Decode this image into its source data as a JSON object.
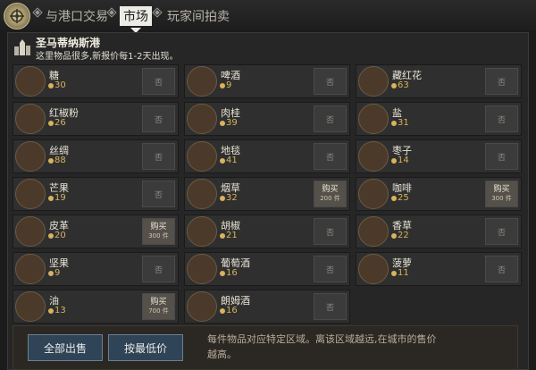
{
  "tabs": [
    {
      "label": "与港口交易",
      "active": false
    },
    {
      "label": "市场",
      "active": true
    },
    {
      "label": "玩家间拍卖",
      "active": false
    }
  ],
  "port": {
    "name": "圣马蒂纳斯港",
    "description": "这里物品很多,新报价每1-2天出现。"
  },
  "goods": [
    {
      "name": "糖",
      "qty": "30",
      "action": "否",
      "price": "",
      "icon": "sugar-sack-icon"
    },
    {
      "name": "啤酒",
      "qty": "9",
      "action": "否",
      "price": "",
      "icon": "beer-barrel-icon"
    },
    {
      "name": "藏红花",
      "qty": "63",
      "action": "否",
      "price": "",
      "icon": "saffron-icon"
    },
    {
      "name": "红椒粉",
      "qty": "26",
      "action": "否",
      "price": "",
      "icon": "paprika-icon"
    },
    {
      "name": "肉桂",
      "qty": "39",
      "action": "否",
      "price": "",
      "icon": "cinnamon-icon"
    },
    {
      "name": "盐",
      "qty": "31",
      "action": "否",
      "price": "",
      "icon": "salt-icon"
    },
    {
      "name": "丝绸",
      "qty": "88",
      "action": "否",
      "price": "",
      "icon": "silk-icon"
    },
    {
      "name": "地毯",
      "qty": "41",
      "action": "否",
      "price": "",
      "icon": "carpet-icon"
    },
    {
      "name": "枣子",
      "qty": "14",
      "action": "否",
      "price": "",
      "icon": "dates-icon"
    },
    {
      "name": "芒果",
      "qty": "19",
      "action": "否",
      "price": "",
      "icon": "mango-crate-icon"
    },
    {
      "name": "烟草",
      "qty": "32",
      "action": "购买",
      "price": "200 件",
      "icon": "tobacco-icon"
    },
    {
      "name": "咖啡",
      "qty": "25",
      "action": "购买",
      "price": "300 件",
      "icon": "coffee-sack-icon"
    },
    {
      "name": "皮革",
      "qty": "20",
      "action": "购买",
      "price": "300 件",
      "icon": "leather-icon"
    },
    {
      "name": "胡椒",
      "qty": "21",
      "action": "否",
      "price": "",
      "icon": "pepper-icon"
    },
    {
      "name": "香草",
      "qty": "22",
      "action": "否",
      "price": "",
      "icon": "vanilla-icon"
    },
    {
      "name": "坚果",
      "qty": "9",
      "action": "否",
      "price": "",
      "icon": "nuts-sack-icon"
    },
    {
      "name": "葡萄酒",
      "qty": "16",
      "action": "否",
      "price": "",
      "icon": "wine-bottle-icon"
    },
    {
      "name": "菠萝",
      "qty": "11",
      "action": "否",
      "price": "",
      "icon": "pineapple-crate-icon"
    },
    {
      "name": "油",
      "qty": "13",
      "action": "购买",
      "price": "700 件",
      "icon": "oil-jar-icon"
    },
    {
      "name": "朗姆酒",
      "qty": "16",
      "action": "否",
      "price": "",
      "icon": "rum-barrel-icon"
    }
  ],
  "actions": {
    "sell_all": "全部出售",
    "lowest_price": "按最低价"
  },
  "note": "每件物品对应特定区域。离该区域越远,在城市的售价越高。"
}
